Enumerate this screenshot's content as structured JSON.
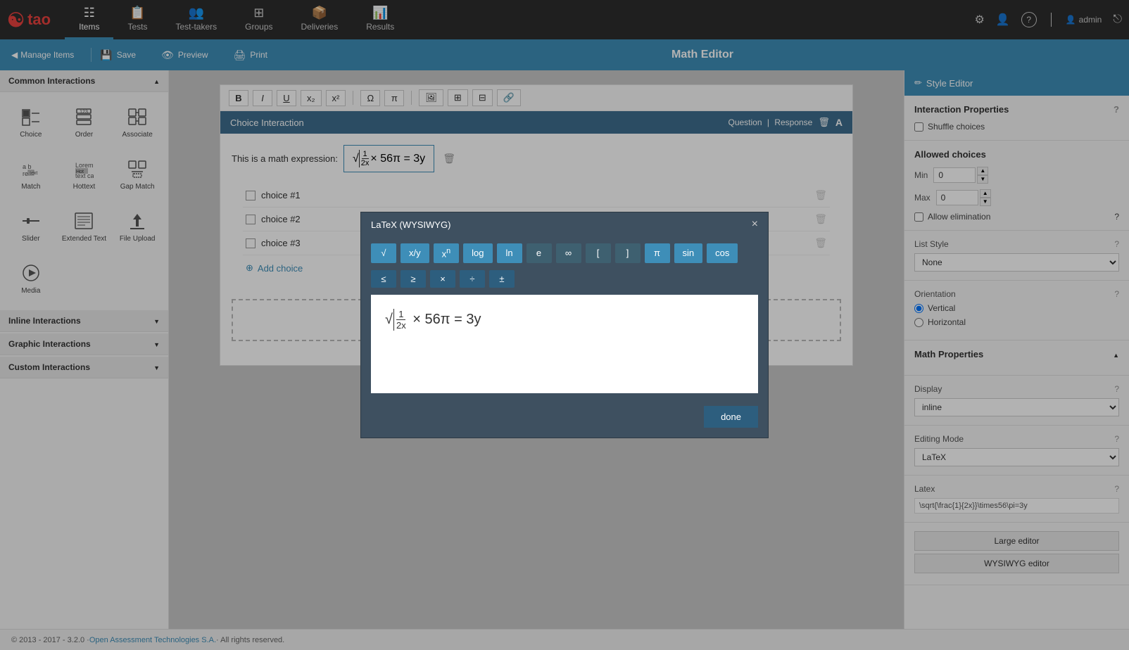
{
  "app": {
    "logo": "tao",
    "logo_icon": "☯"
  },
  "nav": {
    "items": [
      {
        "id": "items",
        "label": "Items",
        "icon": "☰",
        "active": true
      },
      {
        "id": "tests",
        "label": "Tests",
        "icon": "📋",
        "active": false
      },
      {
        "id": "test-takers",
        "label": "Test-takers",
        "icon": "👥",
        "active": false
      },
      {
        "id": "groups",
        "label": "Groups",
        "icon": "⊞",
        "active": false
      },
      {
        "id": "deliveries",
        "label": "Deliveries",
        "icon": "📦",
        "active": false
      },
      {
        "id": "results",
        "label": "Results",
        "icon": "📊",
        "active": false
      }
    ],
    "right": {
      "gear": "⚙",
      "user_manage": "👤",
      "help": "?",
      "user_label": "admin",
      "logout": "⏏"
    }
  },
  "second_toolbar": {
    "back_label": "Manage Items",
    "save_label": "Save",
    "preview_label": "Preview",
    "print_label": "Print",
    "editor_title": "Math Editor"
  },
  "left_sidebar": {
    "common_interactions_label": "Common Interactions",
    "interactions": [
      {
        "id": "choice",
        "label": "Choice",
        "icon": "☑"
      },
      {
        "id": "order",
        "label": "Order",
        "icon": "🔢"
      },
      {
        "id": "associate",
        "label": "Associate",
        "icon": "⊞"
      },
      {
        "id": "match",
        "label": "Match",
        "icon": "ab"
      },
      {
        "id": "hottext",
        "label": "Hottext",
        "icon": "T"
      },
      {
        "id": "gap-match",
        "label": "Gap Match",
        "icon": "⊟"
      },
      {
        "id": "slider",
        "label": "Slider",
        "icon": "⊣"
      },
      {
        "id": "extended-text",
        "label": "Extended Text",
        "icon": "≡"
      },
      {
        "id": "file-upload",
        "label": "File Upload",
        "icon": "↑"
      },
      {
        "id": "media",
        "label": "Media",
        "icon": "▶"
      }
    ],
    "inline_interactions_label": "Inline Interactions",
    "graphic_interactions_label": "Graphic Interactions",
    "custom_interactions_label": "Custom Interactions"
  },
  "choice_interaction": {
    "title": "Choice Interaction",
    "question_label": "Question",
    "response_label": "Response",
    "math_expression_label": "This is a math expression:",
    "math_expression": "√(1/2x) × 56π = 3y",
    "choices": [
      {
        "id": "choice1",
        "label": "choice #1"
      },
      {
        "id": "choice2",
        "label": "choice #2"
      },
      {
        "id": "choice3",
        "label": "choice #3"
      }
    ],
    "add_choice_label": "Add choice"
  },
  "latex_dialog": {
    "title": "LaTeX (WYSIWYG)",
    "close_btn": "×",
    "buttons_row1": [
      "√",
      "x/y",
      "xⁿ",
      "log",
      "ln",
      "e",
      "∞",
      "[",
      "]",
      "π",
      "sin",
      "cos"
    ],
    "buttons_row2": [
      "≤",
      "≥",
      "×",
      "÷",
      "±"
    ],
    "math_content": "√(1/2x) × 56π = 3y",
    "done_label": "done"
  },
  "rich_toolbar": {
    "bold": "B",
    "italic": "I",
    "underline": "U",
    "subscript": "x₂",
    "superscript": "x²",
    "omega": "Ω",
    "pi": "π",
    "img1": "🖼",
    "img2": "⊞",
    "link": "⊟",
    "chain": "🔗"
  },
  "right_sidebar": {
    "style_editor_label": "Style Editor",
    "interaction_properties_label": "Interaction Properties",
    "shuffle_choices_label": "Shuffle choices",
    "allowed_choices_label": "Allowed choices",
    "min_label": "Min",
    "max_label": "Max",
    "min_value": "0",
    "max_value": "0",
    "allow_elimination_label": "Allow elimination",
    "list_style_label": "List Style",
    "list_style_value": "None",
    "orientation_label": "Orientation",
    "vertical_label": "Vertical",
    "horizontal_label": "Horizontal",
    "math_properties_label": "Math Properties",
    "display_label": "Display",
    "display_value": "inline",
    "editing_mode_label": "Editing Mode",
    "editing_mode_value": "LaTeX",
    "latex_label": "Latex",
    "latex_value": "\\sqrt{\\frac{1}{2x}}\\times56\\pi=3y",
    "large_editor_label": "Large editor",
    "wysiwyg_editor_label": "WYSIWYG editor"
  },
  "footer": {
    "copyright": "© 2013 - 2017 - 3.2.0 · ",
    "company_link": "Open Assessment Technologies S.A.",
    "rights": " · All rights reserved."
  }
}
